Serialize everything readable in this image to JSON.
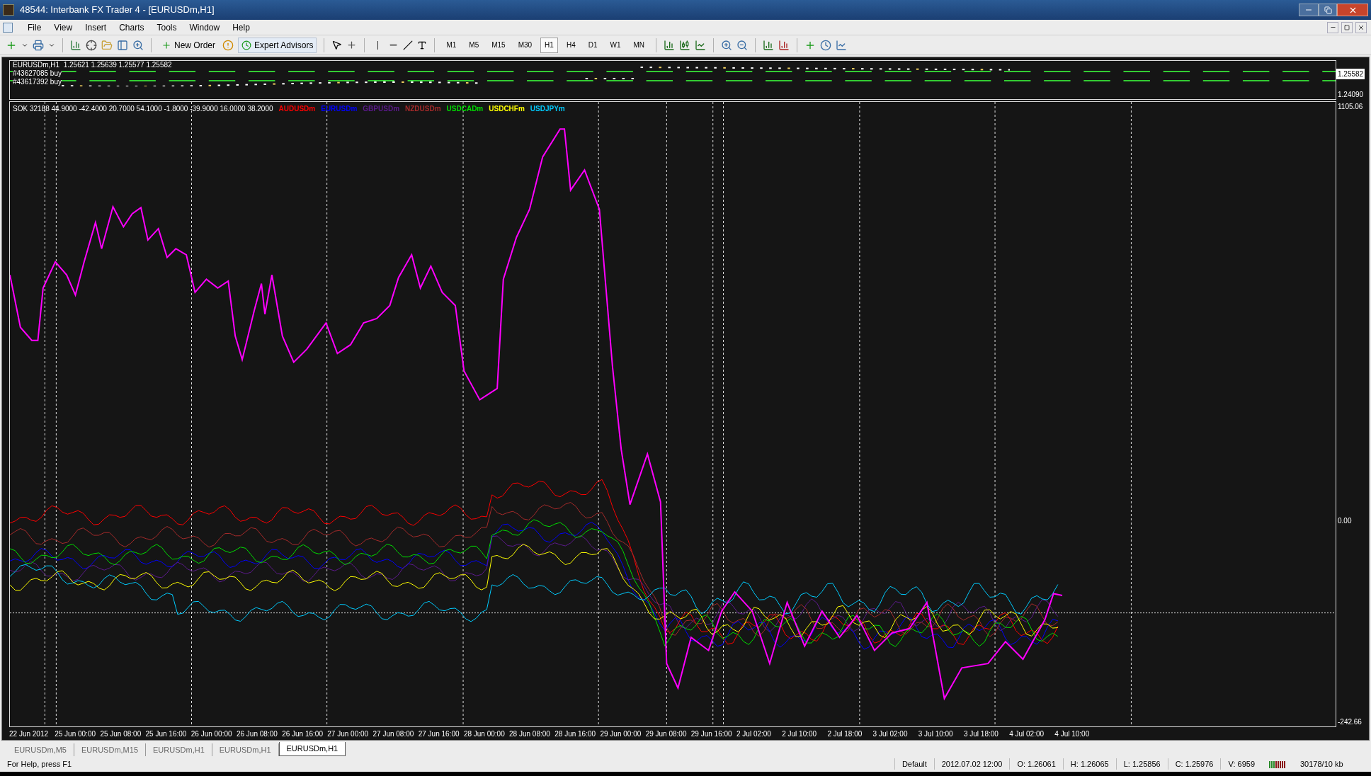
{
  "window": {
    "title": "48544: Interbank FX Trader 4 - [EURUSDm,H1]"
  },
  "menu": [
    "File",
    "View",
    "Insert",
    "Charts",
    "Tools",
    "Window",
    "Help"
  ],
  "toolbar": {
    "new_order": "New Order",
    "expert_advisors": "Expert Advisors",
    "timeframes": [
      {
        "label": "M1",
        "selected": false
      },
      {
        "label": "M5",
        "selected": false
      },
      {
        "label": "M15",
        "selected": false
      },
      {
        "label": "M30",
        "selected": false
      },
      {
        "label": "H1",
        "selected": true
      },
      {
        "label": "H4",
        "selected": false
      },
      {
        "label": "D1",
        "selected": false
      },
      {
        "label": "W1",
        "selected": false
      },
      {
        "label": "MN",
        "selected": false
      }
    ]
  },
  "price_panel": {
    "header": "EURUSDm,H1  1.25621 1.25639 1.25577 1.25582",
    "orders": [
      "#43627085 buy",
      "#43617392 buy"
    ],
    "axis": [
      {
        "label": "1.25582",
        "selected": true
      },
      {
        "label": "1.24090",
        "selected": false
      }
    ]
  },
  "indicator": {
    "header": "SOK 32188 44.9000 -42.4000 20.7000 54.1000 -1.8000 -39.9000 16.0000 38.2000",
    "legend": [
      {
        "name": "AUDUSDm",
        "color": "#ff0000"
      },
      {
        "name": "EURUSDm",
        "color": "#0000ff"
      },
      {
        "name": "GBPUSDm",
        "color": "#5c1a8c"
      },
      {
        "name": "NZDUSDm",
        "color": "#a52a2a"
      },
      {
        "name": "USDCADm",
        "color": "#00dd00"
      },
      {
        "name": "USDCHFm",
        "color": "#ffff00"
      },
      {
        "name": "USDJPYm",
        "color": "#00ccff"
      }
    ],
    "axis": [
      "1105.06",
      "0.00",
      "-242.66"
    ]
  },
  "time_axis": [
    "22 Jun 2012",
    "25 Jun 00:00",
    "25 Jun 08:00",
    "25 Jun 16:00",
    "26 Jun 00:00",
    "26 Jun 08:00",
    "26 Jun 16:00",
    "27 Jun 00:00",
    "27 Jun 08:00",
    "27 Jun 16:00",
    "28 Jun 00:00",
    "28 Jun 08:00",
    "28 Jun 16:00",
    "29 Jun 00:00",
    "29 Jun 08:00",
    "29 Jun 16:00",
    "2 Jul 02:00",
    "2 Jul 10:00",
    "2 Jul 18:00",
    "3 Jul 02:00",
    "3 Jul 10:00",
    "3 Jul 18:00",
    "4 Jul 02:00",
    "4 Jul 10:00"
  ],
  "chart_tabs": [
    {
      "label": "EURUSDm,M5",
      "selected": false
    },
    {
      "label": "EURUSDm,M15",
      "selected": false
    },
    {
      "label": "EURUSDm,H1",
      "selected": false
    },
    {
      "label": "EURUSDm,H1",
      "selected": false
    },
    {
      "label": "EURUSDm,H1",
      "selected": true
    }
  ],
  "status_bar": [
    "For Help, press F1",
    "Default",
    "2012.07.02 12:00",
    "O: 1.26061",
    "H: 1.26065",
    "L: 1.25856",
    "C: 1.25976",
    "V: 6959",
    "30178/10 kb"
  ]
}
